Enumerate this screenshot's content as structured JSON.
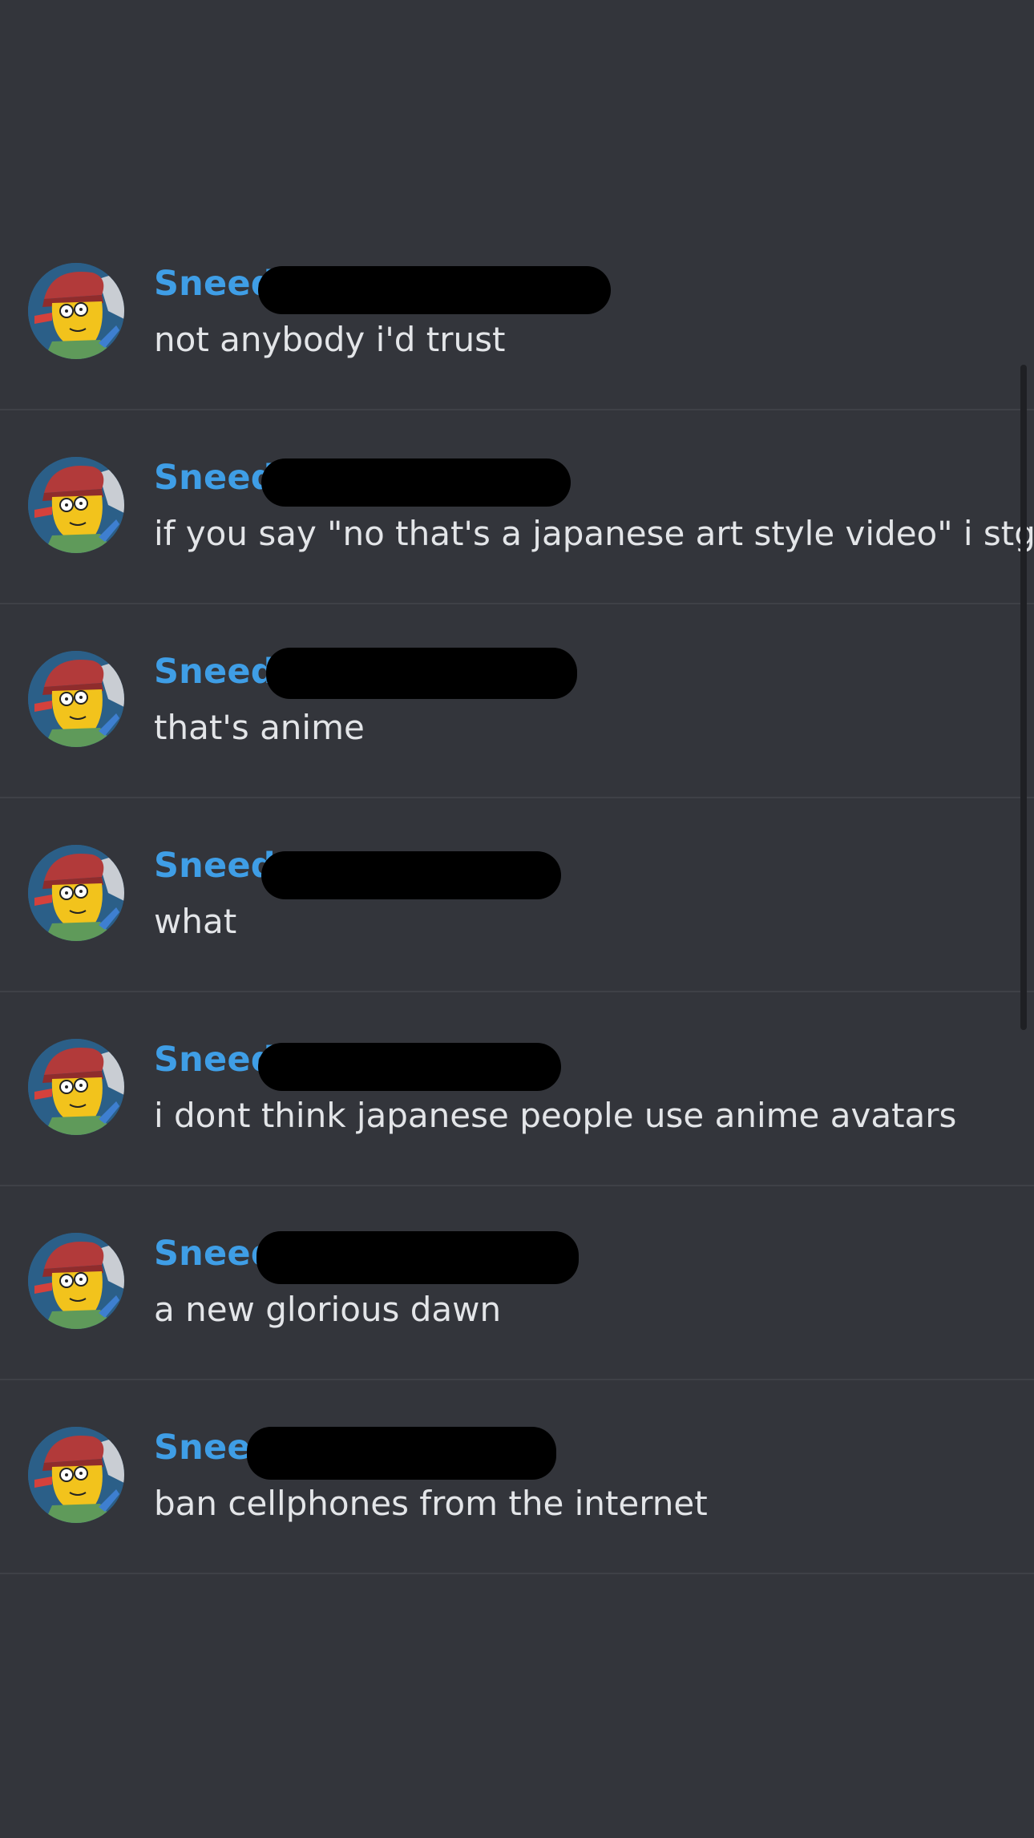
{
  "messages": [
    {
      "author": "Sneed",
      "text": "not anybody i'd trust"
    },
    {
      "author": "Sneed",
      "text": "if you say \"no that's a japanese art style video\" i stg"
    },
    {
      "author": "Sneed",
      "text": "that's anime"
    },
    {
      "author": "Sneed",
      "text": "what"
    },
    {
      "author": "Sneed",
      "text": "i dont think japanese people use anime avatars"
    },
    {
      "author": "Sneed",
      "text": "a new glorious dawn"
    },
    {
      "author": "Sneed",
      "text": "ban cellphones from the internet"
    }
  ],
  "colors": {
    "background": "#33353b",
    "author": "#3f9ee6",
    "text": "#e3e5e8",
    "divider": "#3f4147",
    "redaction": "#000000"
  },
  "icons": {
    "avatar": "cartoon-avatar-icon"
  }
}
